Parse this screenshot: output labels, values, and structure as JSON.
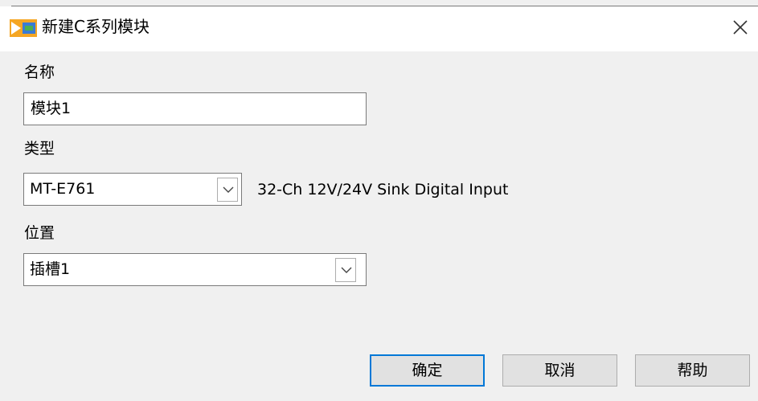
{
  "window": {
    "title": "新建C系列模块",
    "colors": {
      "accent": "#0078d7",
      "icon_orange": "#f5a623",
      "icon_green": "#4caf50"
    }
  },
  "fields": {
    "name_label": "名称",
    "name_value": "模块1",
    "type_label": "类型",
    "type_value": "MT-E761",
    "type_description": "32-Ch 12V/24V Sink Digital Input",
    "location_label": "位置",
    "location_value": "插槽1"
  },
  "buttons": {
    "ok": "确定",
    "cancel": "取消",
    "help": "帮助"
  },
  "icons": {
    "app": "labview-vi-icon",
    "close": "close-icon",
    "dropdown": "chevron-down-icon"
  }
}
